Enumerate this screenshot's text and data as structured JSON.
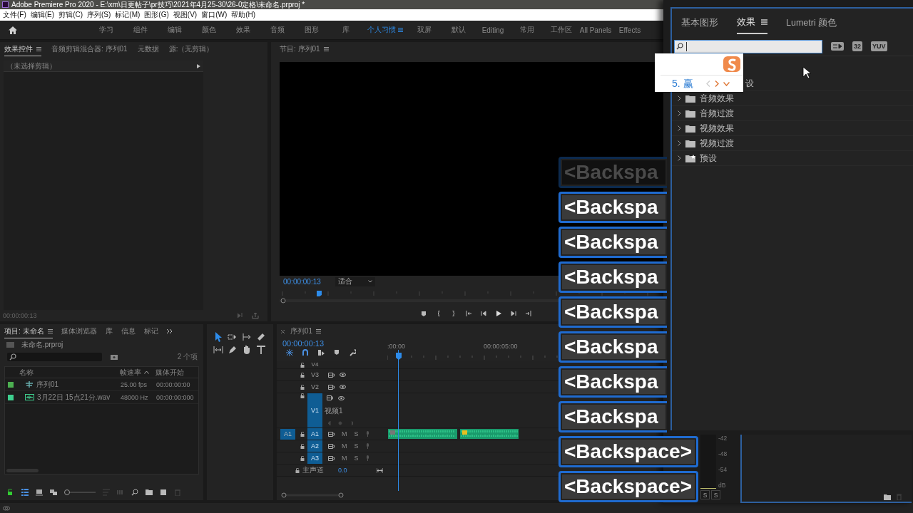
{
  "window": {
    "title": "Adobe Premiere Pro 2020 - E:\\xm\\日更帖子\\pr技巧\\2021年4月25-30\\26-0定格\\未命名.prproj *"
  },
  "menu": [
    "文件(F)",
    "编辑(E)",
    "剪辑(C)",
    "序列(S)",
    "标记(M)",
    "图形(G)",
    "视图(V)",
    "窗口(W)",
    "帮助(H)"
  ],
  "workspaces": [
    {
      "label": "学习",
      "selected": false
    },
    {
      "label": "组件",
      "selected": false
    },
    {
      "label": "编辑",
      "selected": false
    },
    {
      "label": "颜色",
      "selected": false
    },
    {
      "label": "效果",
      "selected": false
    },
    {
      "label": "音频",
      "selected": false
    },
    {
      "label": "图形",
      "selected": false
    },
    {
      "label": "库",
      "selected": false
    },
    {
      "label": "个人习惯",
      "selected": true
    },
    {
      "label": "双屏",
      "selected": false
    },
    {
      "label": "默认",
      "selected": false
    },
    {
      "label": "Editing",
      "selected": false
    },
    {
      "label": "常用",
      "selected": false
    },
    {
      "label": "工作区",
      "selected": false
    },
    {
      "label": "All Panels",
      "selected": false
    },
    {
      "label": "Effects",
      "selected": false
    }
  ],
  "effect_controls": {
    "tabs": [
      {
        "label": "效果控件",
        "selected": true
      },
      {
        "label": "音频剪辑混合器: 序列01",
        "selected": false
      },
      {
        "label": "元数据",
        "selected": false
      },
      {
        "label": "源:（无剪辑）",
        "selected": false
      }
    ],
    "clip_row": "（未选择剪辑）",
    "timecode": "00:00:00:13"
  },
  "program": {
    "title": "节目: 序列01",
    "timecode": "00:00:00:13",
    "zoom": "适合"
  },
  "project": {
    "zoom_slider": {
      "level": 0
    },
    "tabs": [
      {
        "label": "项目: 未命名",
        "selected": true
      },
      {
        "label": "媒体浏览器",
        "selected": false
      },
      {
        "label": "库",
        "selected": false
      },
      {
        "label": "信息",
        "selected": false
      },
      {
        "label": "标记",
        "selected": false
      }
    ],
    "file": "未命名.prproj",
    "count": "2 个项",
    "columns": [
      {
        "label": "名称",
        "sorted": false
      },
      {
        "label": "帧速率",
        "sorted": true
      },
      {
        "label": "媒体开始",
        "sorted": false
      }
    ],
    "rows": [
      {
        "color": "#4caf50",
        "kind": "sequence",
        "name": "序列01",
        "rate": "25.00 fps",
        "start": "00:00:00:00"
      },
      {
        "color": "#3ecf8e",
        "kind": "audio",
        "name": "3月22日 15点21分.wav",
        "rate": "48000 Hz",
        "start": "00:00:00:000"
      }
    ]
  },
  "timeline": {
    "title": "序列01",
    "timecode": "00:00:00:13",
    "ruler": [
      ":00:00",
      "00:00:05:00"
    ],
    "tracks": [
      {
        "kind": "cut",
        "label": "V4",
        "targeted": false
      },
      {
        "kind": "video",
        "label": "V3",
        "targeted": false
      },
      {
        "kind": "video",
        "label": "V2",
        "targeted": false
      },
      {
        "kind": "video-open",
        "label": "V1",
        "name": "视频1",
        "targeted": true
      },
      {
        "kind": "audio",
        "label": "A1",
        "source": "A1",
        "targeted": true,
        "mute": "M",
        "solo": "S"
      },
      {
        "kind": "audio",
        "label": "A2",
        "targeted": true,
        "mute": "M",
        "solo": "S"
      },
      {
        "kind": "audio",
        "label": "A3",
        "targeted": true,
        "mute": "M",
        "solo": "S"
      },
      {
        "kind": "master",
        "label": "主声道",
        "value": "0.0"
      }
    ]
  },
  "effects_panel": {
    "tabs": [
      {
        "label": "基本图形",
        "selected": false
      },
      {
        "label": "效果",
        "selected": true
      },
      {
        "label": "Lumetri 颜色",
        "selected": false
      }
    ],
    "badges": [
      "32",
      "YUV"
    ],
    "items": [
      {
        "kind": "covered",
        "label": "设"
      },
      {
        "kind": "folder",
        "label": "音频效果"
      },
      {
        "kind": "folder",
        "label": "音频过渡"
      },
      {
        "kind": "folder",
        "label": "视频效果"
      },
      {
        "kind": "folder",
        "label": "视频过渡"
      },
      {
        "kind": "preset",
        "label": "预设"
      }
    ]
  },
  "ime": {
    "candidate": "5. 赢"
  },
  "keys": [
    {
      "text": "<Backspa",
      "cut": true,
      "faded": true
    },
    {
      "text": "<Backspa",
      "cut": true,
      "faded": false
    },
    {
      "text": "<Backspa",
      "cut": true,
      "faded": false
    },
    {
      "text": "<Backspa",
      "cut": true,
      "faded": false
    },
    {
      "text": "<Backspa",
      "cut": true,
      "faded": false
    },
    {
      "text": "<Backspa",
      "cut": true,
      "faded": false
    },
    {
      "text": "<Backspa",
      "cut": true,
      "faded": false
    },
    {
      "text": "<Backspa",
      "cut": true,
      "faded": false
    },
    {
      "text": "<Backspace>",
      "cut": false,
      "faded": false
    },
    {
      "text": "<Backspace>",
      "cut": false,
      "faded": false
    }
  ],
  "meter": {
    "ticks": [
      "-42",
      "-48",
      "-54",
      "dB"
    ],
    "solo": [
      "S",
      "S"
    ]
  }
}
